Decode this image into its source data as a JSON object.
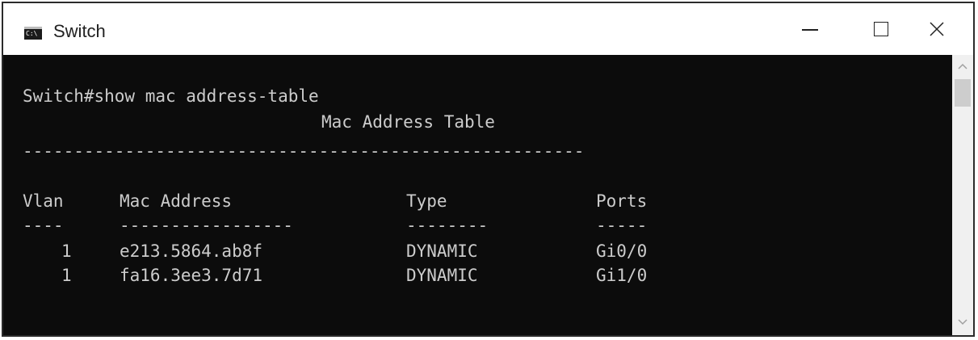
{
  "window": {
    "title": "Switch",
    "icon": "console-icon",
    "icon_text": "C:\\"
  },
  "controls": {
    "minimize": "minimize-icon",
    "maximize": "maximize-icon",
    "close": "close-icon"
  },
  "terminal": {
    "prompt_line": "Switch#show mac address-table",
    "table_title": "Mac Address Table",
    "separator": "-------------------------------------------------------",
    "headers": {
      "vlan": "Vlan",
      "mac": "Mac Address",
      "type": "Type",
      "ports": "Ports"
    },
    "underlines": {
      "vlan": "----",
      "mac": "-----------------",
      "type": "--------",
      "ports": "-----"
    },
    "rows": [
      {
        "vlan": "1",
        "mac": "e213.5864.ab8f",
        "type": "DYNAMIC",
        "ports": "Gi0/0"
      },
      {
        "vlan": "1",
        "mac": "fa16.3ee3.7d71",
        "type": "DYNAMIC",
        "ports": "Gi1/0"
      }
    ]
  },
  "colors": {
    "terminal_bg": "#0c0c0c",
    "terminal_fg": "#cccccc"
  }
}
